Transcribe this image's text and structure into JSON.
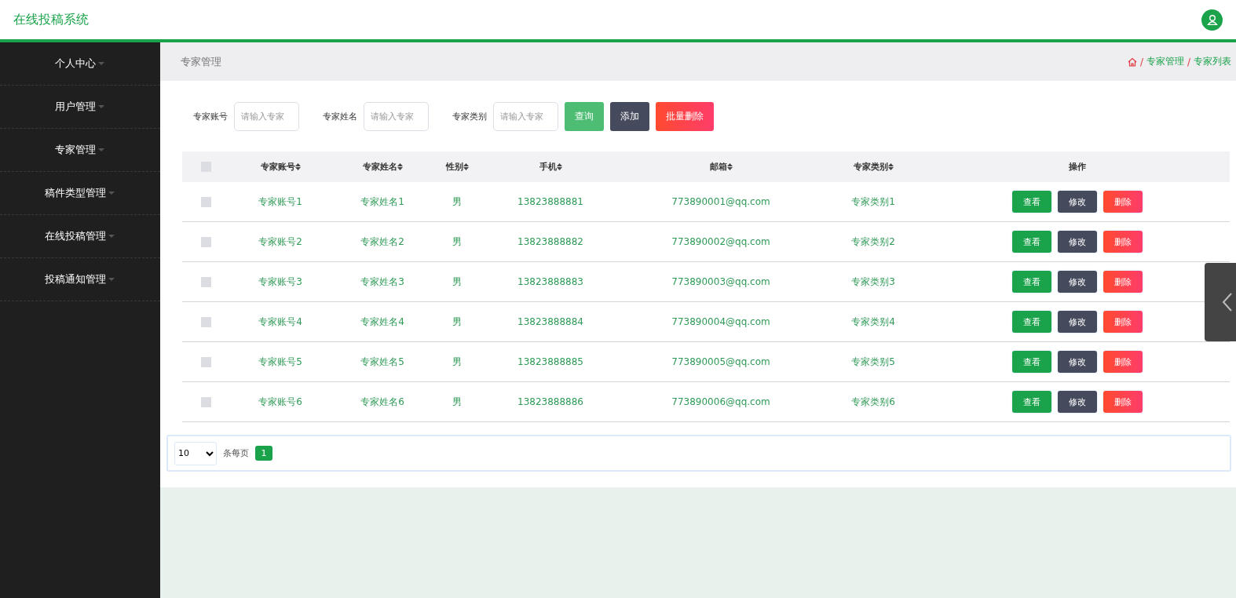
{
  "header": {
    "title": "在线投稿系统"
  },
  "sidebar": {
    "items": [
      {
        "label": "个人中心"
      },
      {
        "label": "用户管理"
      },
      {
        "label": "专家管理"
      },
      {
        "label": "稿件类型管理"
      },
      {
        "label": "在线投稿管理"
      },
      {
        "label": "投稿通知管理"
      }
    ]
  },
  "breadcrumb": {
    "page_title": "专家管理",
    "trail": [
      {
        "separator": "/",
        "label": "专家管理"
      },
      {
        "separator": "/",
        "label": "专家列表"
      }
    ]
  },
  "filters": [
    {
      "label": "专家账号",
      "placeholder": "请输入专家"
    },
    {
      "label": "专家姓名",
      "placeholder": "请输入专家"
    },
    {
      "label": "专家类别",
      "placeholder": "请输入专家"
    }
  ],
  "toolbar_buttons": [
    {
      "label": "查询",
      "kind": "search"
    },
    {
      "label": "添加",
      "kind": "add"
    },
    {
      "label": "批量删除",
      "kind": "delete"
    }
  ],
  "table": {
    "select_all": {
      "checked": false
    },
    "columns": [
      {
        "label": "专家账号",
        "sortable": true
      },
      {
        "label": "专家姓名",
        "sortable": true
      },
      {
        "label": "性别",
        "sortable": true
      },
      {
        "label": "手机",
        "sortable": true
      },
      {
        "label": "邮箱",
        "sortable": true
      },
      {
        "label": "专家类别",
        "sortable": true
      },
      {
        "label": "操作",
        "sortable": false
      }
    ],
    "rows": [
      {
        "checked": false,
        "cells": [
          "专家账号1",
          "专家姓名1",
          "男",
          "13823888881",
          "773890001@qq.com",
          "专家类别1"
        ],
        "actions": [
          {
            "label": "查看",
            "kind": "view"
          },
          {
            "label": "修改",
            "kind": "edit"
          },
          {
            "label": "删除",
            "kind": "delete"
          }
        ]
      },
      {
        "checked": false,
        "cells": [
          "专家账号2",
          "专家姓名2",
          "男",
          "13823888882",
          "773890002@qq.com",
          "专家类别2"
        ],
        "actions": [
          {
            "label": "查看",
            "kind": "view"
          },
          {
            "label": "修改",
            "kind": "edit"
          },
          {
            "label": "删除",
            "kind": "delete"
          }
        ]
      },
      {
        "checked": false,
        "cells": [
          "专家账号3",
          "专家姓名3",
          "男",
          "13823888883",
          "773890003@qq.com",
          "专家类别3"
        ],
        "actions": [
          {
            "label": "查看",
            "kind": "view"
          },
          {
            "label": "修改",
            "kind": "edit"
          },
          {
            "label": "删除",
            "kind": "delete"
          }
        ]
      },
      {
        "checked": false,
        "cells": [
          "专家账号4",
          "专家姓名4",
          "男",
          "13823888884",
          "773890004@qq.com",
          "专家类别4"
        ],
        "actions": [
          {
            "label": "查看",
            "kind": "view"
          },
          {
            "label": "修改",
            "kind": "edit"
          },
          {
            "label": "删除",
            "kind": "delete"
          }
        ]
      },
      {
        "checked": false,
        "cells": [
          "专家账号5",
          "专家姓名5",
          "男",
          "13823888885",
          "773890005@qq.com",
          "专家类别5"
        ],
        "actions": [
          {
            "label": "查看",
            "kind": "view"
          },
          {
            "label": "修改",
            "kind": "edit"
          },
          {
            "label": "删除",
            "kind": "delete"
          }
        ]
      },
      {
        "checked": false,
        "cells": [
          "专家账号6",
          "专家姓名6",
          "男",
          "13823888886",
          "773890006@qq.com",
          "专家类别6"
        ],
        "actions": [
          {
            "label": "查看",
            "kind": "view"
          },
          {
            "label": "修改",
            "kind": "edit"
          },
          {
            "label": "删除",
            "kind": "delete"
          }
        ]
      }
    ]
  },
  "pagination": {
    "page_size": "10",
    "per_page_label": "条每页",
    "pages": [
      {
        "label": "1",
        "selected": true
      }
    ]
  }
}
